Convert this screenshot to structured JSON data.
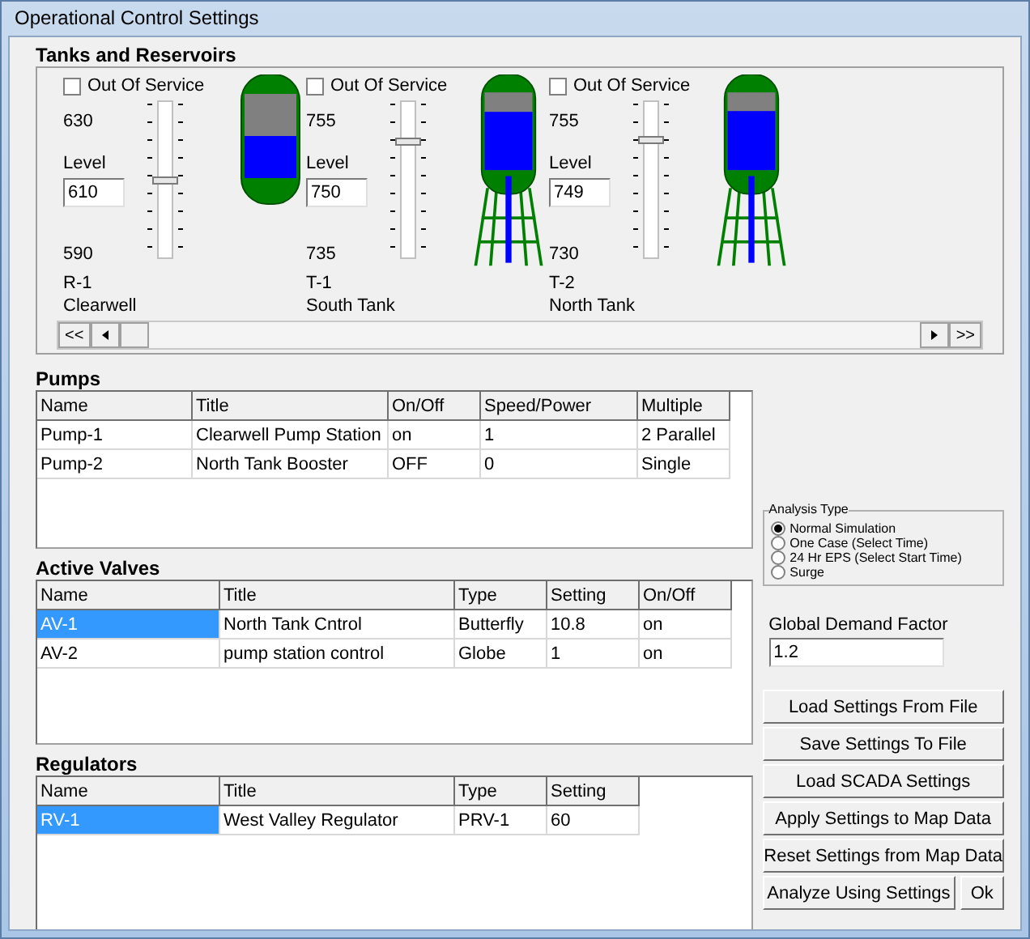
{
  "window": {
    "title": "Operational Control Settings"
  },
  "tanks_panel": {
    "title": "Tanks and Reservoirs",
    "tanks": [
      {
        "kind": "reservoir",
        "out_of_service": {
          "label": "Out Of Service",
          "checked": false
        },
        "max": "630",
        "level_label": "Level",
        "value": "610",
        "min": "590",
        "id": "R-1",
        "name": "Clearwell",
        "level": 0.5
      },
      {
        "kind": "elevated",
        "out_of_service": {
          "label": "Out Of Service",
          "checked": false
        },
        "max": "755",
        "level_label": "Level",
        "value": "750",
        "min": "735",
        "id": "T-1",
        "name": "South Tank",
        "level": 0.75
      },
      {
        "kind": "elevated",
        "out_of_service": {
          "label": "Out Of Service",
          "checked": false
        },
        "max": "755",
        "level_label": "Level",
        "value": "749",
        "min": "730",
        "id": "T-2",
        "name": "North Tank",
        "level": 0.76
      }
    ],
    "scroll_first": "<<",
    "scroll_last": ">>"
  },
  "pumps": {
    "title": "Pumps",
    "columns": [
      "Name",
      "Title",
      "On/Off",
      "Speed/Power",
      "Multiple"
    ],
    "rows": [
      {
        "cells": [
          "Pump-1",
          "Clearwell Pump Station",
          "on",
          "1",
          "2 Parallel"
        ],
        "selected": false
      },
      {
        "cells": [
          "Pump-2",
          "North Tank Booster",
          "OFF",
          "0",
          "Single"
        ],
        "selected": false
      }
    ]
  },
  "active_valves": {
    "title": "Active Valves",
    "columns": [
      "Name",
      "Title",
      "Type",
      "Setting",
      "On/Off"
    ],
    "rows": [
      {
        "cells": [
          "AV-1",
          "North Tank Cntrol",
          "Butterfly",
          "10.8",
          "on"
        ],
        "selected": true
      },
      {
        "cells": [
          "AV-2",
          "pump station control",
          "Globe",
          "1",
          "on"
        ],
        "selected": false
      }
    ]
  },
  "regulators": {
    "title": "Regulators",
    "columns": [
      "Name",
      "Title",
      "Type",
      "Setting"
    ],
    "rows": [
      {
        "cells": [
          "RV-1",
          "West Valley Regulator",
          "PRV-1",
          "60"
        ],
        "selected": true
      }
    ]
  },
  "analysis_type": {
    "title": "Analysis Type",
    "options": [
      {
        "label": "Normal Simulation",
        "selected": true
      },
      {
        "label": "One Case (Select Time)",
        "selected": false
      },
      {
        "label": "24 Hr EPS (Select Start Time)",
        "selected": false
      },
      {
        "label": "Surge",
        "selected": false
      }
    ]
  },
  "global_demand_factor": {
    "label": "Global Demand Factor",
    "value": "1.2"
  },
  "buttons": [
    "Load Settings From File",
    "Save Settings To File",
    "Load SCADA Settings",
    "Apply Settings to Map Data",
    "Reset Settings from Map Data"
  ],
  "bottom_buttons": [
    "Analyze Using Settings",
    "Ok"
  ]
}
